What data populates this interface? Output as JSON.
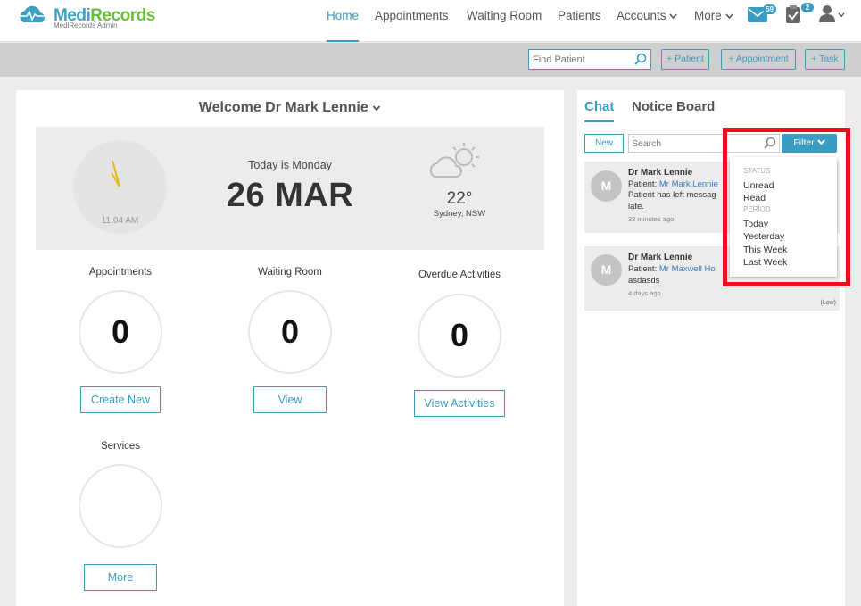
{
  "brand": {
    "name_part1": "Medi",
    "name_part2": "Records",
    "subtitle": "MediRecords Admin"
  },
  "nav": {
    "items": [
      "Home",
      "Appointments",
      "Waiting Room",
      "Patients",
      "Accounts",
      "More"
    ],
    "messages_badge": "59",
    "tasks_badge": "2"
  },
  "toolbar": {
    "find_placeholder": "Find Patient",
    "add_patient": "+ Patient",
    "add_appointment": "+ Appointment",
    "add_task": "+ Task"
  },
  "welcome": {
    "text": "Welcome Dr Mark Lennie"
  },
  "hero": {
    "clock_time": "11:04 AM",
    "today_label": "Today is Monday",
    "date": "26 MAR",
    "temperature": "22°",
    "location": "Sydney, NSW"
  },
  "widgets": {
    "appointments": {
      "title": "Appointments",
      "count": "0",
      "button": "Create New"
    },
    "waiting_room": {
      "title": "Waiting Room",
      "count": "0",
      "button": "View"
    },
    "overdue": {
      "title": "Overdue Activities",
      "count": "0",
      "button": "View Activities"
    },
    "services": {
      "title": "Services",
      "button": "More"
    }
  },
  "side": {
    "tab_chat": "Chat",
    "tab_notice": "Notice Board",
    "new_label": "New",
    "search_placeholder": "Search",
    "filter_label": "Filter"
  },
  "messages": [
    {
      "initial": "M",
      "name": "Dr Mark Lennie",
      "patient_prefix": "Patient:",
      "patient": "Mr Mark Lennie",
      "line1": "Patient has left messag",
      "line2": "late.",
      "time": "33 minutes ago"
    },
    {
      "initial": "M",
      "name": "Dr Mark Lennie",
      "patient_prefix": "Patient:",
      "patient": "Mr Maxwell Ho",
      "line1": "asdasds",
      "time": "4 days ago",
      "priority": "(Low)"
    }
  ],
  "filter_menu": {
    "status_header": "STATUS",
    "unread": "Unread",
    "read": "Read",
    "period_header": "PERIOD",
    "today": "Today",
    "yesterday": "Yesterday",
    "this_week": "This Week",
    "last_week": "Last Week"
  },
  "colors": {
    "accent": "#3a9cc0",
    "highlight": "#e8121e",
    "brand_green": "#6bbd3a"
  }
}
